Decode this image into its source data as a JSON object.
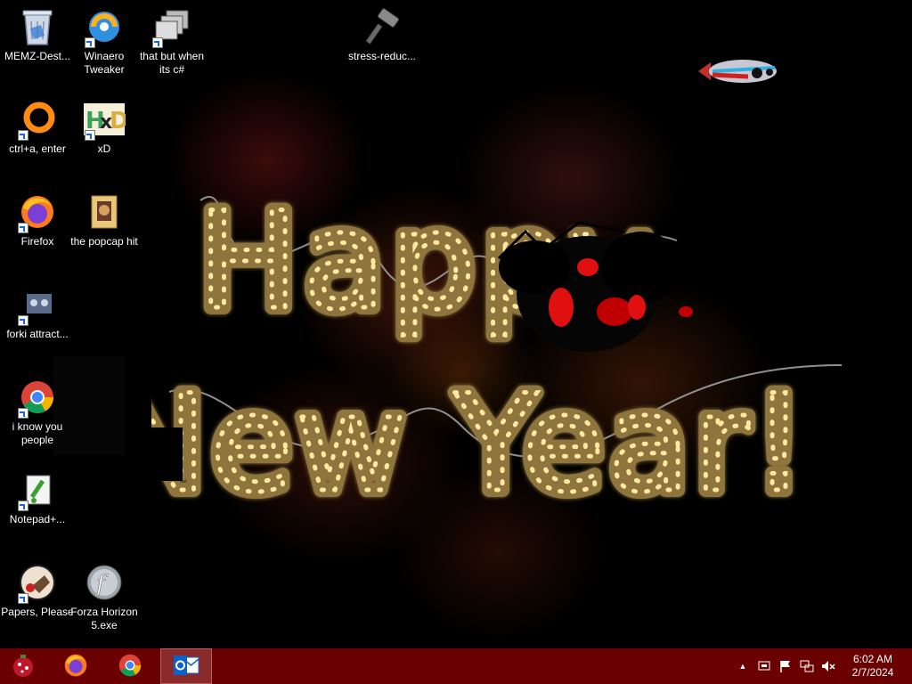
{
  "desktop": {
    "greeting_line1": "Happy",
    "greeting_line2": "New Year!",
    "icons": [
      {
        "label": "MEMZ-Dest...",
        "icon": "recycle-bin-icon"
      },
      {
        "label": "Winaero Tweaker",
        "icon": "winaero-tweaker-icon"
      },
      {
        "label": "that but when its c#",
        "icon": "stacked-windows-icon"
      },
      {
        "label": "stress-reduc...",
        "icon": "hammer-icon"
      },
      {
        "label": "ctrl+a, enter",
        "icon": "orange-ring-icon"
      },
      {
        "label": "xD",
        "icon": "hxd-icon"
      },
      {
        "label": "Firefox",
        "icon": "firefox-icon"
      },
      {
        "label": "the popcap hit",
        "icon": "folder-icon"
      },
      {
        "label": "forki attract...",
        "icon": "forkit-icon"
      },
      {
        "label": "i know you people",
        "icon": "chrome-icon"
      },
      {
        "label": "Notepad+...",
        "icon": "notepad-plus-icon"
      },
      {
        "label": "Papers, Please",
        "icon": "papers-please-icon"
      },
      {
        "label": "Forza Horizon 5.exe",
        "icon": "flash-icon"
      }
    ]
  },
  "taskbar": {
    "apps": [
      {
        "name": "Start",
        "icon": "christmas-ornament-icon"
      },
      {
        "name": "Firefox",
        "icon": "firefox-icon"
      },
      {
        "name": "Google Chrome",
        "icon": "chrome-icon"
      },
      {
        "name": "Outlook",
        "icon": "outlook-icon",
        "active": true
      }
    ],
    "tray": {
      "chevron": "▲",
      "time": "6:02 AM",
      "date": "2/7/2024"
    }
  },
  "colors": {
    "taskbar": "#6b0000",
    "bulb": "#ffe9a0",
    "tube": "#a58a4a"
  }
}
